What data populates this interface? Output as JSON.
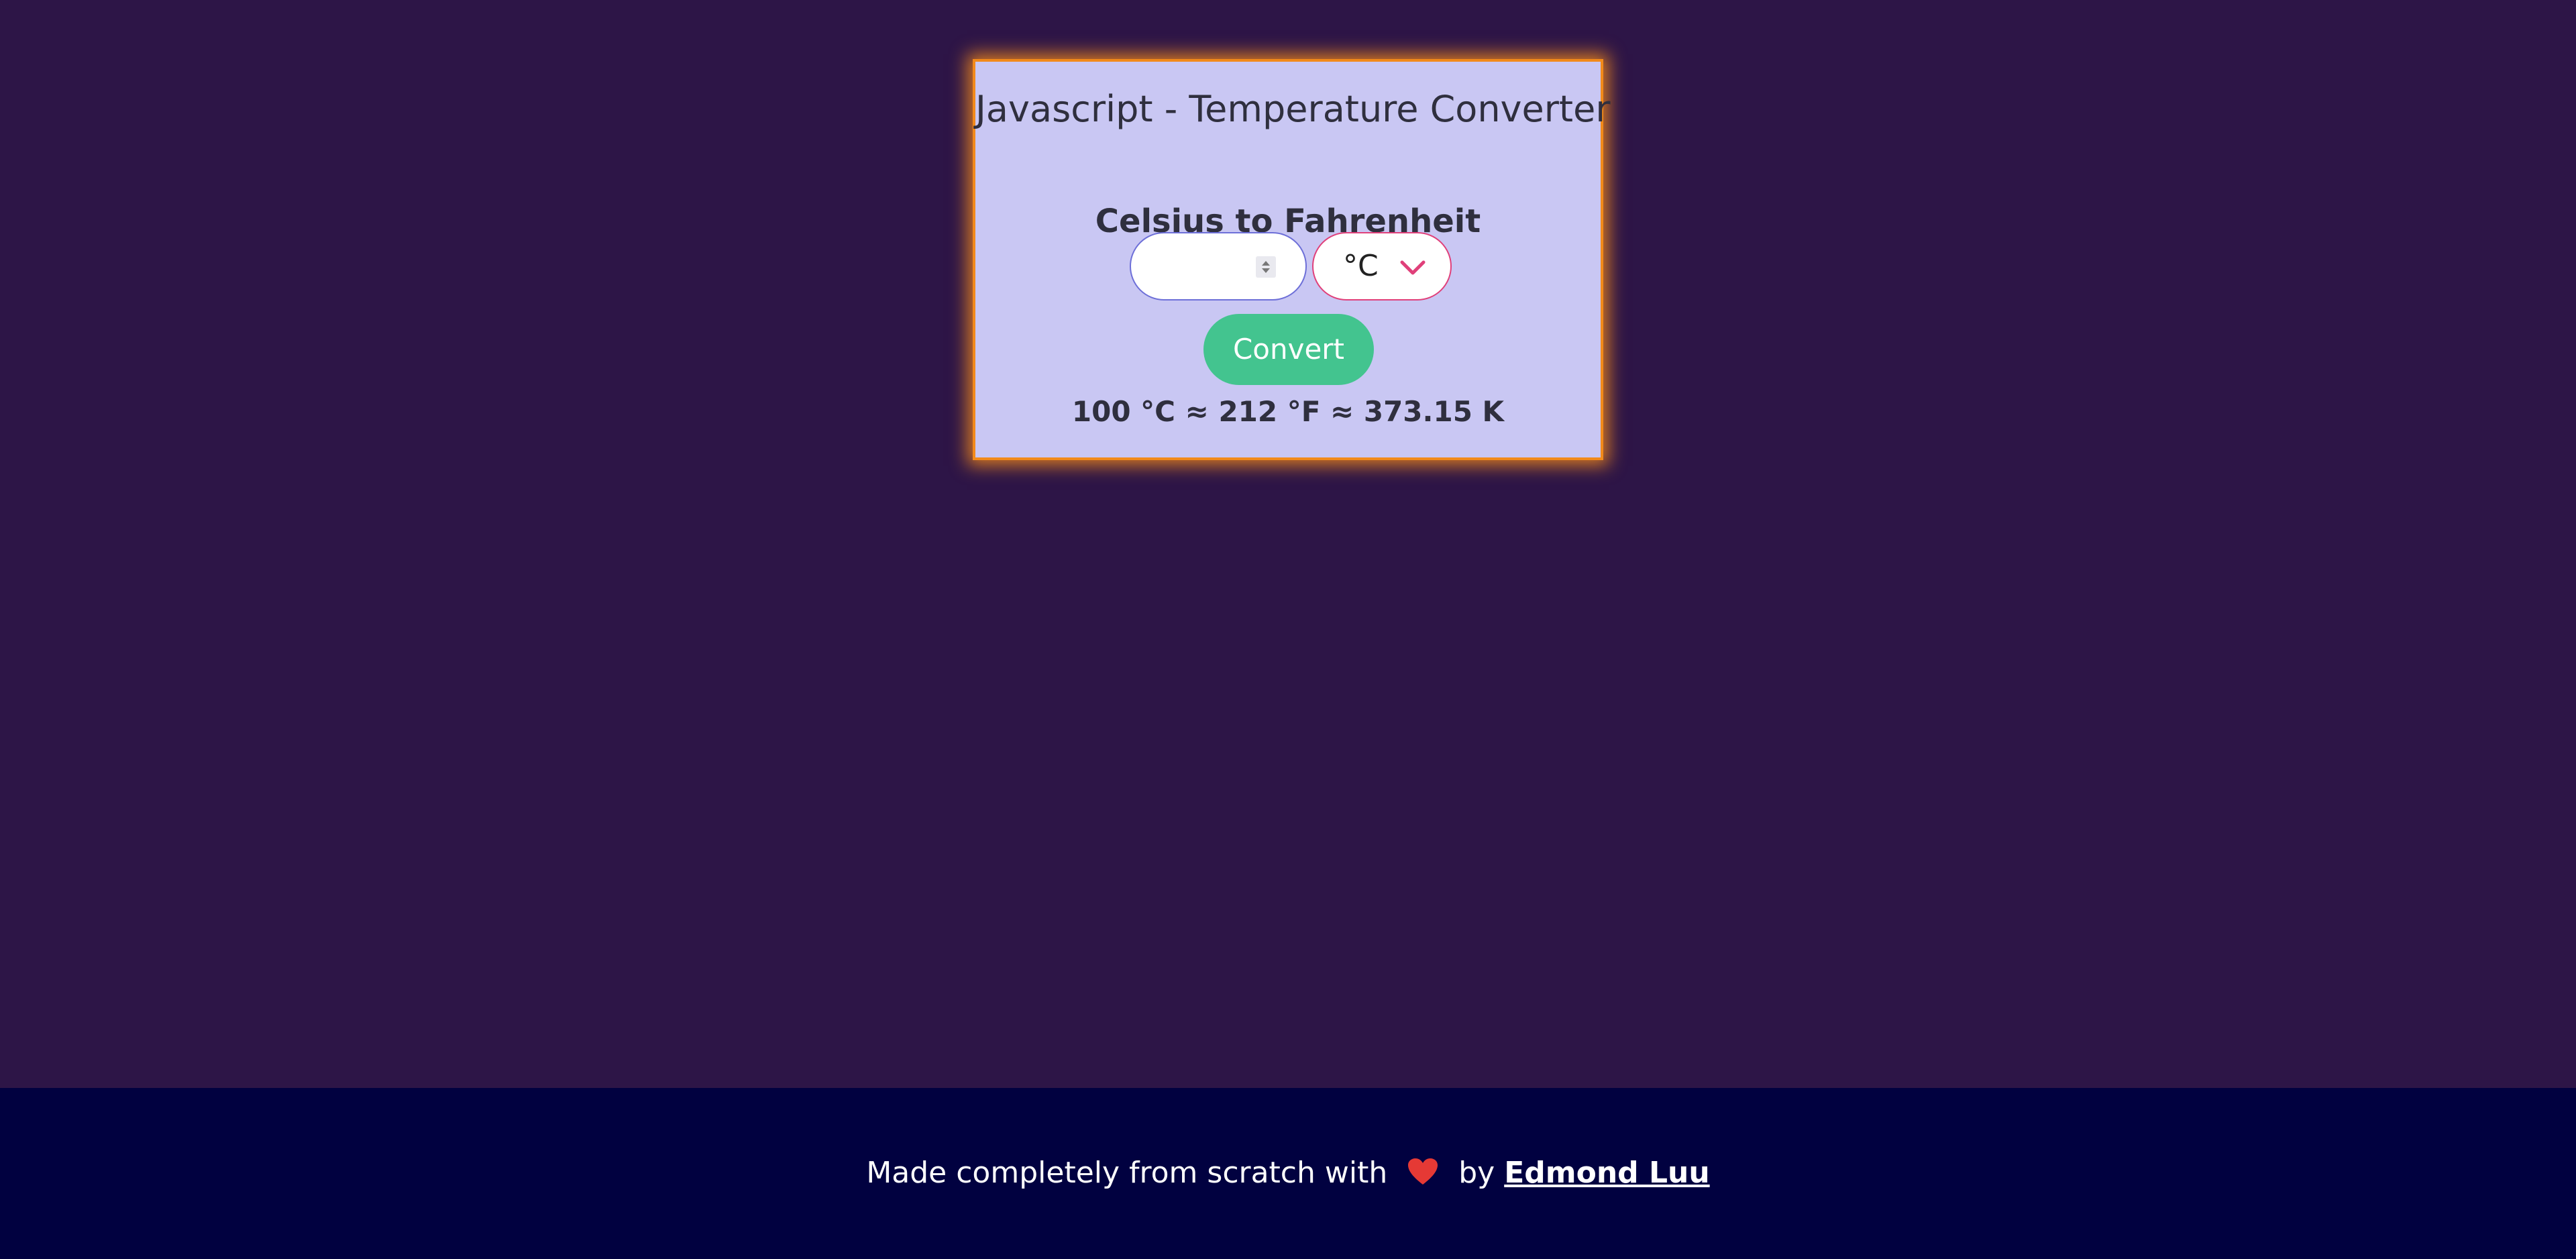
{
  "app": {
    "title": "Javascript - Temperature Converter",
    "subtitle": "Celsius to Fahrenheit"
  },
  "form": {
    "number_input": {
      "value": "",
      "placeholder": ""
    },
    "unit_select": {
      "selected": "°C"
    },
    "convert_label": "Convert"
  },
  "result": {
    "text": "100 °C ≈ 212 °F ≈ 373.15 K"
  },
  "footer": {
    "prefix": "Made completely from scratch with",
    "by": "by",
    "author": "Edmond Luu"
  },
  "icons": {
    "heart": "heart-icon",
    "chevron": "chevron-down-icon",
    "spinner": "spinner-icon"
  },
  "colors": {
    "page_background": "#2d1547",
    "card_background": "#c9c7f3",
    "card_border": "#f28a1a",
    "button": "#43c48f",
    "select_border": "#e0407a",
    "footer_background": "#010140",
    "heart": "#e53935"
  }
}
